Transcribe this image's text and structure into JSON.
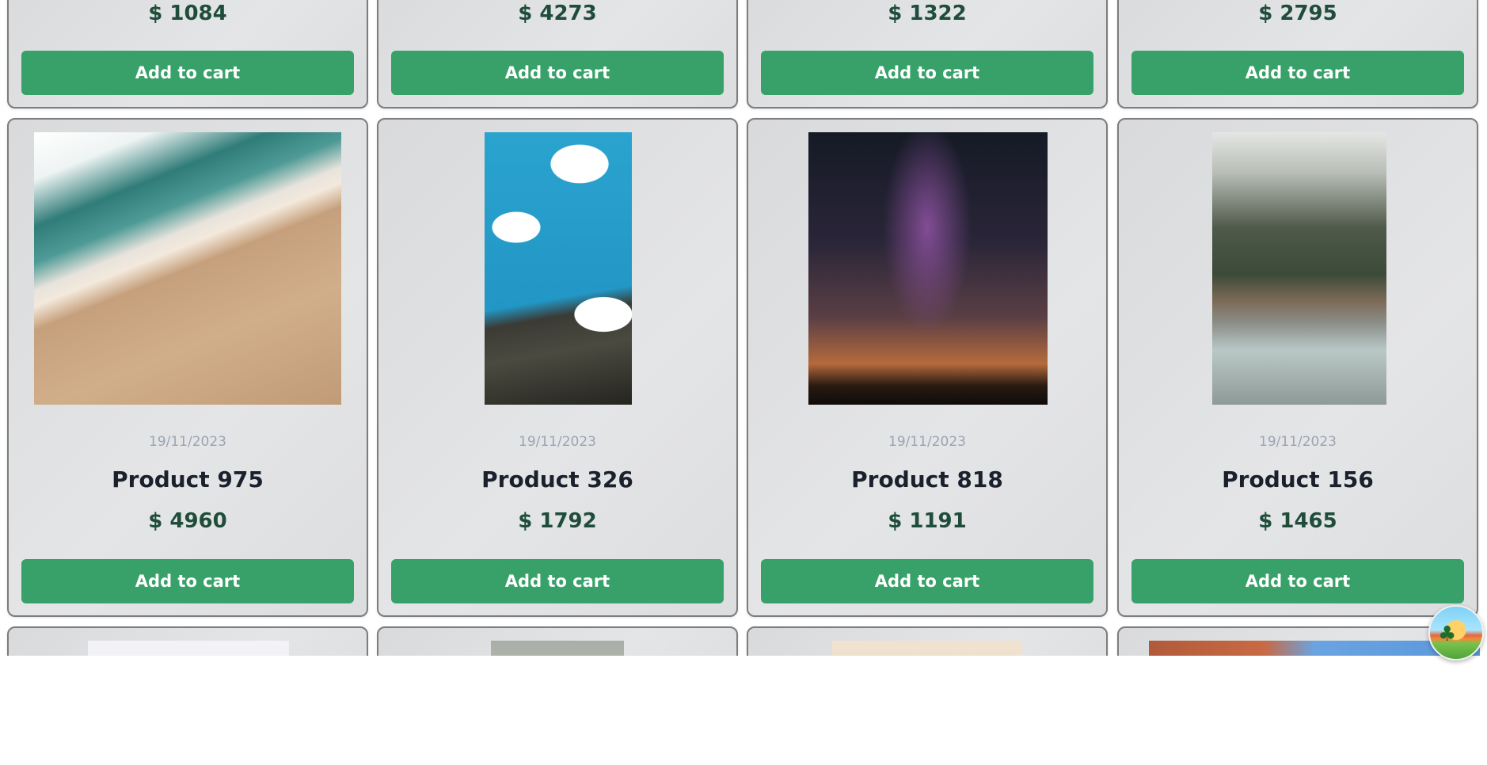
{
  "top_row": [
    {
      "price": "$ 1084",
      "button": "Add to cart"
    },
    {
      "price": "$ 4273",
      "button": "Add to cart"
    },
    {
      "price": "$ 1322",
      "button": "Add to cart"
    },
    {
      "price": "$ 2795",
      "button": "Add to cart"
    }
  ],
  "products": [
    {
      "image": "beach-waves-photo",
      "date": "19/11/2023",
      "name": "Product 975",
      "price": "$ 4960",
      "button": "Add to cart"
    },
    {
      "image": "rock-summit-clouds-photo",
      "date": "19/11/2023",
      "name": "Product 326",
      "price": "$ 1792",
      "button": "Add to cart"
    },
    {
      "image": "milky-way-night-photo",
      "date": "19/11/2023",
      "name": "Product 818",
      "price": "$ 1191",
      "button": "Add to cart"
    },
    {
      "image": "misty-forest-river-photo",
      "date": "19/11/2023",
      "name": "Product 156",
      "price": "$ 1465",
      "button": "Add to cart"
    }
  ],
  "bottom_row": [
    {
      "image": "light-sky-photo"
    },
    {
      "image": "cloudy-sky-photo"
    },
    {
      "image": "hazy-horizon-photo"
    },
    {
      "image": "red-rock-blue-sky-photo"
    }
  ],
  "theme": {
    "button_color": "#38a169",
    "price_color": "#1f4d3a",
    "date_color": "#9aa4b3"
  },
  "floating_widget": {
    "icon": "tropical-island-icon"
  }
}
